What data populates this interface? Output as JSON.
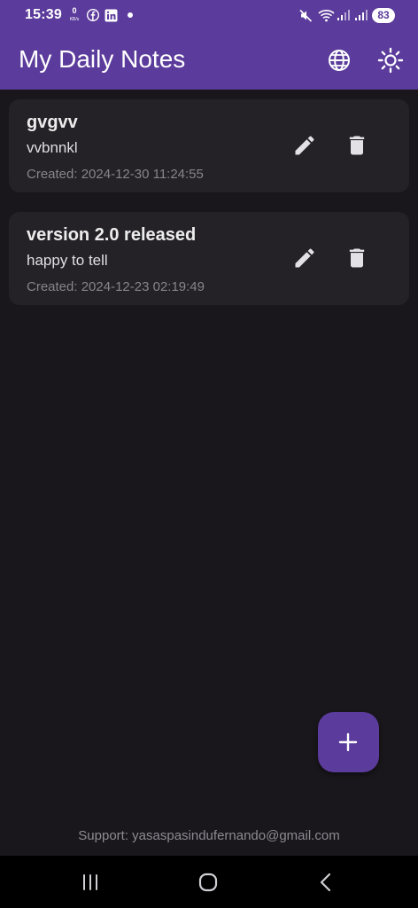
{
  "status_bar": {
    "time": "15:39",
    "net_speed_value": "0",
    "net_speed_unit": "KB/s",
    "battery": "83"
  },
  "app_bar": {
    "title": "My Daily Notes",
    "icons": [
      "language-icon",
      "brightness-icon"
    ]
  },
  "notes": [
    {
      "title": "gvgvv",
      "body": "vvbnnkl",
      "created": "Created: 2024-12-30 11:24:55"
    },
    {
      "title": "version 2.0 released",
      "body": "happy to tell",
      "created": "Created: 2024-12-23 02:19:49"
    }
  ],
  "fab": {
    "icon": "plus-icon"
  },
  "footer": {
    "support": "Support: yasaspasindufernando@gmail.com"
  },
  "nav_bar": {
    "icons": [
      "recent-apps-icon",
      "home-icon",
      "back-icon"
    ]
  },
  "colors": {
    "primary": "#5b3b9b",
    "background": "#19171b",
    "card": "#242226",
    "icon": "#e3e1e6"
  }
}
